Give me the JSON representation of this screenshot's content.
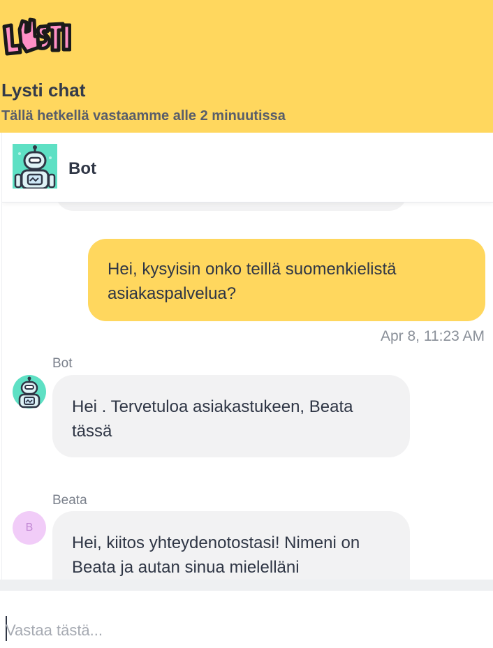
{
  "header": {
    "logo_text": "LYSTI",
    "title": "Lysti chat",
    "subtitle": "Tällä hetkellä vastaamme alle 2 minuutissa",
    "background_color": "#ffd75e"
  },
  "agent_bar": {
    "avatar_icon": "robot-avatar-icon",
    "name": "Bot"
  },
  "messages": [
    {
      "type": "user",
      "text": "Hei, kysyisin onko teillä suomenkielistä asiakaspalvelua?",
      "timestamp": "Apr 8, 11:23 AM"
    },
    {
      "type": "agent",
      "sender": "Bot",
      "avatar_icon": "robot-avatar-icon",
      "text": "Hei . Tervetuloa asiakastukeen, Beata tässä"
    },
    {
      "type": "agent",
      "sender": "Beata",
      "avatar_initial": "B",
      "text": "Hei, kiitos yhteydenotostasi! Nimeni on Beata ja autan sinua mielelläni"
    }
  ],
  "composer": {
    "placeholder": "Vastaa tästä...",
    "value": ""
  },
  "colors": {
    "accent": "#ffd75e",
    "agent_bubble": "#f2f2f3",
    "beata_avatar_bg": "#f1ccf8"
  }
}
